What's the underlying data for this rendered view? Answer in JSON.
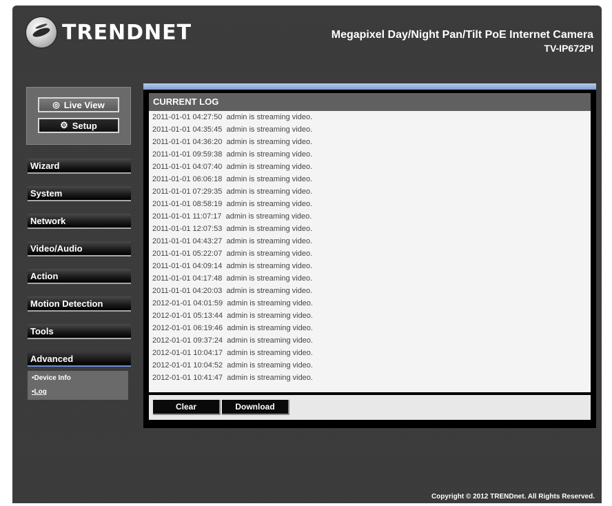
{
  "header": {
    "brand": "TRENDNET",
    "title_line1": "Megapixel Day/Night Pan/Tilt PoE Internet Camera",
    "title_line2": "TV-IP672PI"
  },
  "view_buttons": {
    "live_view": "Live View",
    "setup": "Setup"
  },
  "menu": {
    "items": [
      "Wizard",
      "System",
      "Network",
      "Video/Audio",
      "Action",
      "Motion Detection",
      "Tools",
      "Advanced"
    ],
    "active": "Advanced",
    "submenu": [
      "•Device Info",
      "•Log"
    ]
  },
  "log": {
    "header": "CURRENT LOG",
    "entries": [
      "2011-01-01 04:27:50  admin is streaming video.",
      "2011-01-01 04:35:45  admin is streaming video.",
      "2011-01-01 04:36:20  admin is streaming video.",
      "2011-01-01 09:59:38  admin is streaming video.",
      "2011-01-01 04:07:40  admin is streaming video.",
      "2011-01-01 06:06:18  admin is streaming video.",
      "2011-01-01 07:29:35  admin is streaming video.",
      "2011-01-01 08:58:19  admin is streaming video.",
      "2011-01-01 11:07:17  admin is streaming video.",
      "2011-01-01 12:07:53  admin is streaming video.",
      "2011-01-01 04:43:27  admin is streaming video.",
      "2011-01-01 05:22:07  admin is streaming video.",
      "2011-01-01 04:09:14  admin is streaming video.",
      "2011-01-01 04:17:48  admin is streaming video.",
      "2011-01-01 04:20:03  admin is streaming video.",
      "2012-01-01 04:01:59  admin is streaming video.",
      "2012-01-01 05:13:44  admin is streaming video.",
      "2012-01-01 06:19:46  admin is streaming video.",
      "2012-01-01 09:37:24  admin is streaming video.",
      "2012-01-01 10:04:17  admin is streaming video.",
      "2012-01-01 10:04:52  admin is streaming video.",
      "2012-01-01 10:41:47  admin is streaming video."
    ]
  },
  "actions": {
    "clear": "Clear",
    "download": "Download"
  },
  "footer": {
    "copyright": "Copyright © 2012 TRENDnet. All Rights Reserved."
  }
}
